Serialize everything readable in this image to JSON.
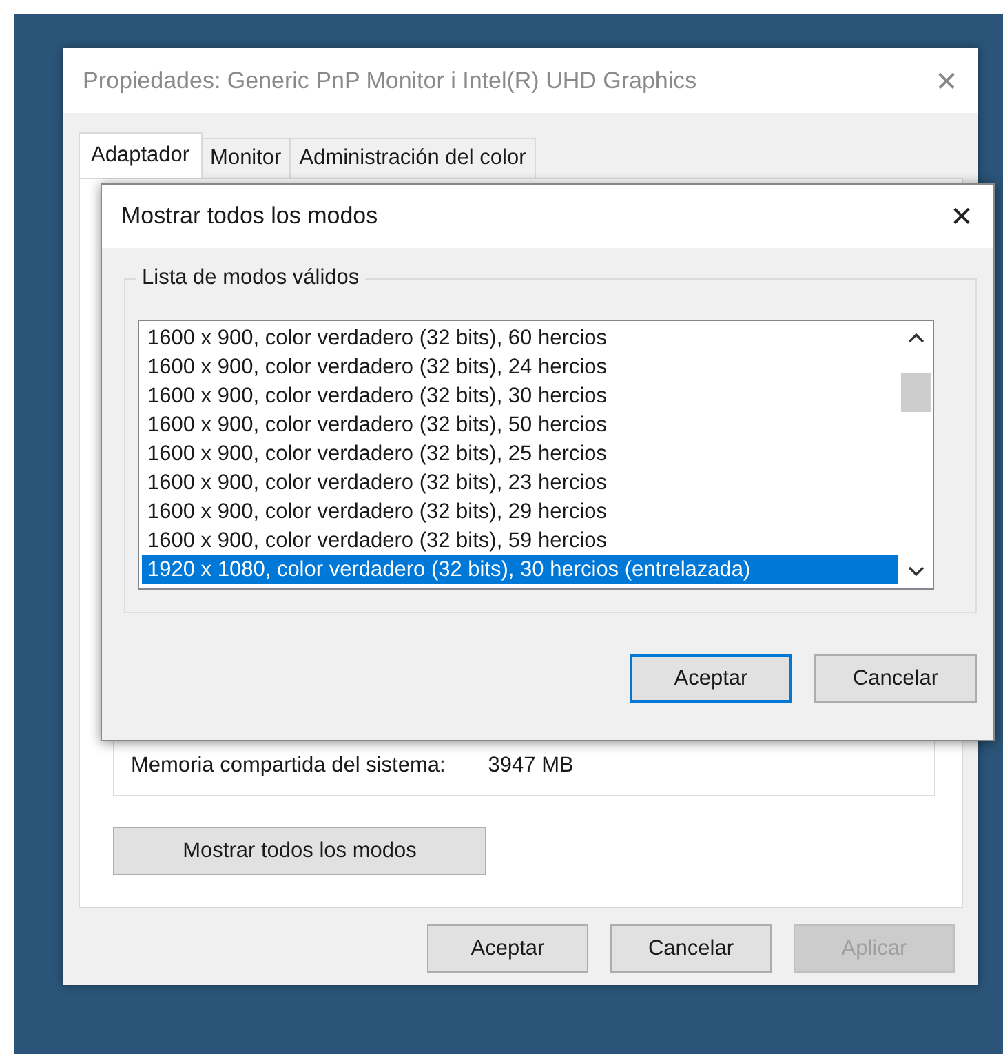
{
  "window": {
    "title": "Propiedades: Generic PnP Monitor i Intel(R) UHD Graphics",
    "close": "✕"
  },
  "tabs": [
    {
      "label": "Adaptador",
      "selected": true
    },
    {
      "label": "Monitor",
      "selected": false
    },
    {
      "label": "Administración del color",
      "selected": false
    }
  ],
  "panel": {
    "memory_label": "Memoria compartida del sistema:",
    "memory_value": "3947 MB",
    "show_modes_button": "Mostrar todos los modos"
  },
  "buttons": [
    {
      "label": "Aceptar",
      "disabled": false
    },
    {
      "label": "Cancelar",
      "disabled": false
    },
    {
      "label": "Aplicar",
      "disabled": true
    }
  ],
  "dialog": {
    "title": "Mostrar todos los modos",
    "close": "✕",
    "group_label": "Lista de modos válidos",
    "modes": [
      {
        "label": "1600 x 900, color verdadero (32 bits), 60 hercios",
        "selected": false
      },
      {
        "label": "1600 x 900, color verdadero (32 bits), 24 hercios",
        "selected": false
      },
      {
        "label": "1600 x 900, color verdadero (32 bits), 30 hercios",
        "selected": false
      },
      {
        "label": "1600 x 900, color verdadero (32 bits), 50 hercios",
        "selected": false
      },
      {
        "label": "1600 x 900, color verdadero (32 bits), 25 hercios",
        "selected": false
      },
      {
        "label": "1600 x 900, color verdadero (32 bits), 23 hercios",
        "selected": false
      },
      {
        "label": "1600 x 900, color verdadero (32 bits), 29 hercios",
        "selected": false
      },
      {
        "label": "1600 x 900, color verdadero (32 bits), 59 hercios",
        "selected": false
      },
      {
        "label": "1920 x 1080, color verdadero (32 bits), 30 hercios (entrelazada)",
        "selected": true
      }
    ],
    "buttons": [
      {
        "label": "Aceptar",
        "default": true
      },
      {
        "label": "Cancelar",
        "default": false
      }
    ]
  }
}
